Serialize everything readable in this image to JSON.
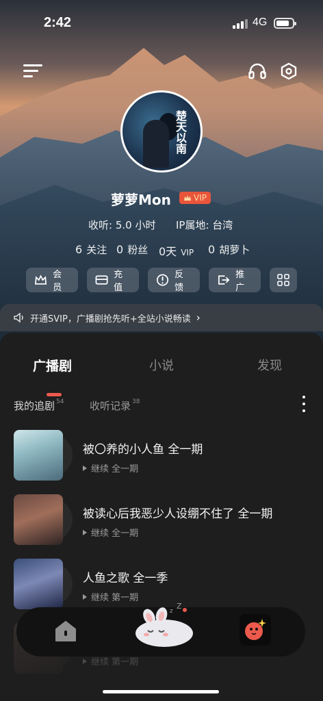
{
  "status_bar": {
    "time": "2:42",
    "network": "4G"
  },
  "profile": {
    "username": "萝萝Mon",
    "vip_label": "VIP",
    "listen_time": "收听: 5.0 小时",
    "ip_location": "IP属地: 台湾",
    "counts": [
      {
        "num": "6",
        "label": "关注"
      },
      {
        "num": "0",
        "label": "粉丝"
      },
      {
        "num": "0天",
        "label": "VIP"
      },
      {
        "num": "0",
        "label": "胡萝卜"
      }
    ]
  },
  "avatar_text": "楚天以南",
  "actions": [
    {
      "label": "会员",
      "icon": "crown-icon"
    },
    {
      "label": "充值",
      "icon": "wallet-icon"
    },
    {
      "label": "反馈",
      "icon": "feedback-icon"
    },
    {
      "label": "推广",
      "icon": "share-icon"
    }
  ],
  "promo_text": "开通SVIP，广播剧抢先听+全站小说畅读",
  "tabs": [
    "广播剧",
    "小说",
    "发现"
  ],
  "subtabs": [
    {
      "label": "我的追剧",
      "count": "54"
    },
    {
      "label": "收听记录",
      "count": "38"
    }
  ],
  "items": [
    {
      "title": "被〇养的小人鱼 全一期",
      "continue": "继续 全一期"
    },
    {
      "title": "被读心后我恶少人设绷不住了 全一期",
      "continue": "继续 全一期"
    },
    {
      "title": "人鱼之歌 全一季",
      "continue": "继续 第一期"
    },
    {
      "title": "",
      "continue": "继续 第一期"
    }
  ],
  "colors": {
    "accent": "#ec5a4c",
    "vip": "#e9553b",
    "panel": "#1e1e1e"
  }
}
